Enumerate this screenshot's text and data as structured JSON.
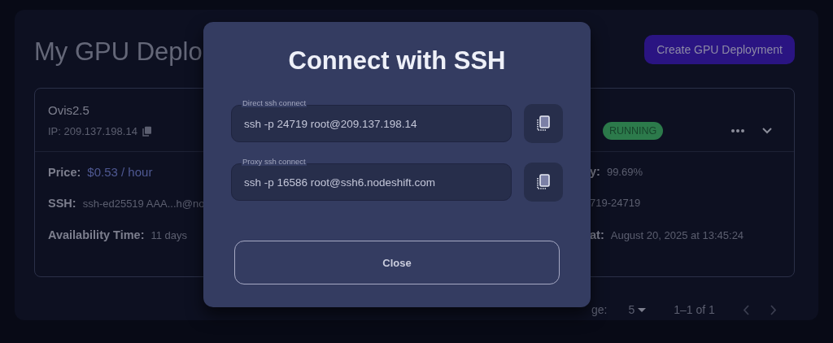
{
  "page": {
    "title": "My GPU Deplo",
    "create_button": "Create GPU Deployment"
  },
  "deployment": {
    "name": "Ovis2.5",
    "ip": "IP: 209.137.198.14",
    "status": "RUNNING",
    "details_left": [
      {
        "label": "Price:",
        "value": "$0.53 / hour",
        "kind": "price"
      },
      {
        "label": "SSH:",
        "value": "ssh-ed25519 AAA...h@no",
        "kind": "plain"
      },
      {
        "label": "Availability Time:",
        "value": "11 days",
        "kind": "plain"
      }
    ],
    "details_right": [
      {
        "label": "y:",
        "value": "99.69%"
      },
      {
        "value": "719-24719"
      },
      {
        "label": "at:",
        "value": "August 20, 2025 at 13:45:24"
      }
    ]
  },
  "pagination": {
    "label": "ge:",
    "per_page": "5",
    "range": "1–1 of 1"
  },
  "dialog": {
    "title": "Connect with SSH",
    "fields": [
      {
        "label": "Direct ssh connect",
        "value": "ssh -p 24719 root@209.137.198.14"
      },
      {
        "label": "Proxy ssh connect",
        "value": "ssh -p 16586 root@ssh6.nodeshift.com"
      }
    ],
    "close": "Close"
  }
}
